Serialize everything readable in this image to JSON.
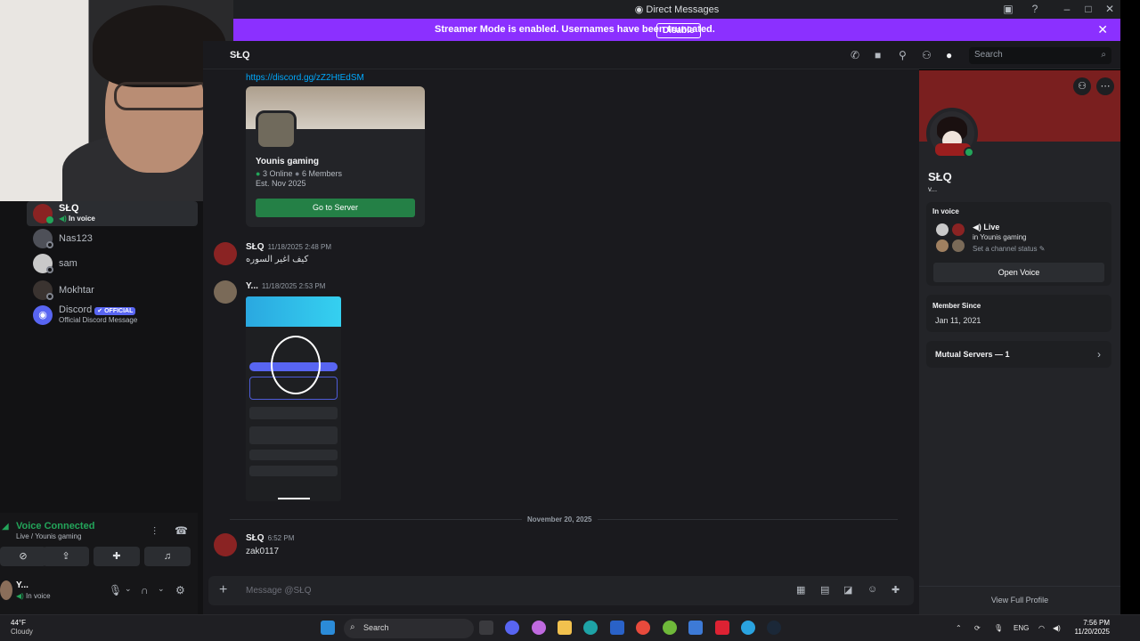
{
  "window": {
    "title": "Direct Messages"
  },
  "banner": {
    "message": "Streamer Mode is enabled. Usernames have been truncated.",
    "button": "Disable"
  },
  "dm_list": [
    {
      "name": "SŁQ",
      "sub": "In voice",
      "active": true
    },
    {
      "name": "Nas123",
      "sub": "",
      "active": false
    },
    {
      "name": "sam",
      "sub": "",
      "active": false
    },
    {
      "name": "Mokhtar",
      "sub": "",
      "active": false
    },
    {
      "name": "Discord",
      "badge": "✔ OFFICIAL",
      "sub": "Official Discord Message",
      "active": false
    }
  ],
  "voice": {
    "status": "Voice Connected",
    "location": "Live / Younis gaming",
    "user_name": "Y...",
    "user_status": "In voice"
  },
  "chat": {
    "header_name": "SŁQ",
    "search_placeholder": "Search",
    "invite_link": "https://discord.gg/zZ2HtEdSM",
    "invite": {
      "server": "Younis gaming",
      "online": "3 Online",
      "members": "6 Members",
      "established": "Est. Nov 2025",
      "button": "Go to Server"
    },
    "messages": [
      {
        "author": "SŁQ",
        "time": "11/18/2025 2:48 PM",
        "text": "كيف اغير السوره"
      },
      {
        "author": "Y...",
        "time": "11/18/2025 2:53 PM",
        "text": ""
      },
      {
        "author": "SŁQ",
        "time": "6:52 PM",
        "text": "zak0117"
      }
    ],
    "date_divider": "November 20, 2025",
    "composer_placeholder": "Message @SŁQ"
  },
  "profile": {
    "name": "SŁQ",
    "tag": "v...",
    "in_voice_label": "In voice",
    "live_label": "Live",
    "live_server": "in Younis gaming",
    "channel_status": "Set a channel status",
    "open_voice": "Open Voice",
    "member_since_label": "Member Since",
    "member_since": "Jan 11, 2021",
    "mutual_servers": "Mutual Servers — 1",
    "view_full": "View Full Profile"
  },
  "taskbar": {
    "weather_temp": "44°F",
    "weather_desc": "Cloudy",
    "search": "Search",
    "lang": "ENG",
    "time": "7:56 PM",
    "date": "11/20/2025"
  },
  "colors": {
    "accent": "#5865f2",
    "banner": "#8b30ff",
    "green": "#23a55a",
    "link": "#00a8fc"
  }
}
